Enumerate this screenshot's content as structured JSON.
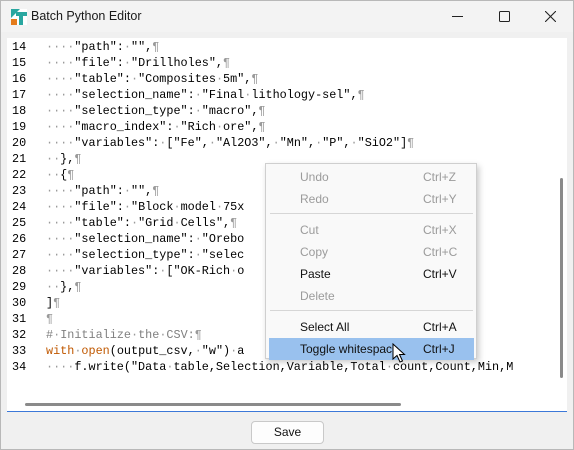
{
  "window": {
    "title": "Batch Python Editor",
    "controls": {
      "minimize": "minimize-icon",
      "maximize": "maximize-icon",
      "close": "close-icon"
    }
  },
  "editor": {
    "line_numbers": [
      "14",
      "15",
      "16",
      "17",
      "18",
      "19",
      "20",
      "21",
      "22",
      "23",
      "24",
      "25",
      "26",
      "27",
      "28",
      "29",
      "30",
      "31",
      "32",
      "33",
      "34"
    ],
    "lines": [
      [
        {
          "t": "····",
          "c": "ws"
        },
        {
          "t": "\"path\":",
          "c": ""
        },
        {
          "t": "·",
          "c": "ws"
        },
        {
          "t": "\"\",",
          "c": ""
        },
        {
          "t": "¶",
          "c": "ws"
        }
      ],
      [
        {
          "t": "····",
          "c": "ws"
        },
        {
          "t": "\"file\":",
          "c": ""
        },
        {
          "t": "·",
          "c": "ws"
        },
        {
          "t": "\"Drillholes\",",
          "c": ""
        },
        {
          "t": "¶",
          "c": "ws"
        }
      ],
      [
        {
          "t": "····",
          "c": "ws"
        },
        {
          "t": "\"table\":",
          "c": ""
        },
        {
          "t": "·",
          "c": "ws"
        },
        {
          "t": "\"Composites",
          "c": ""
        },
        {
          "t": "·",
          "c": "ws"
        },
        {
          "t": "5m\",",
          "c": ""
        },
        {
          "t": "¶",
          "c": "ws"
        }
      ],
      [
        {
          "t": "····",
          "c": "ws"
        },
        {
          "t": "\"selection_name\":",
          "c": ""
        },
        {
          "t": "·",
          "c": "ws"
        },
        {
          "t": "\"Final",
          "c": ""
        },
        {
          "t": "·",
          "c": "ws"
        },
        {
          "t": "lithology-sel\",",
          "c": ""
        },
        {
          "t": "¶",
          "c": "ws"
        }
      ],
      [
        {
          "t": "····",
          "c": "ws"
        },
        {
          "t": "\"selection_type\":",
          "c": ""
        },
        {
          "t": "·",
          "c": "ws"
        },
        {
          "t": "\"macro\",",
          "c": ""
        },
        {
          "t": "¶",
          "c": "ws"
        }
      ],
      [
        {
          "t": "····",
          "c": "ws"
        },
        {
          "t": "\"macro_index\":",
          "c": ""
        },
        {
          "t": "·",
          "c": "ws"
        },
        {
          "t": "\"Rich",
          "c": ""
        },
        {
          "t": "·",
          "c": "ws"
        },
        {
          "t": "ore\",",
          "c": ""
        },
        {
          "t": "¶",
          "c": "ws"
        }
      ],
      [
        {
          "t": "····",
          "c": "ws"
        },
        {
          "t": "\"variables\":",
          "c": ""
        },
        {
          "t": "·",
          "c": "ws"
        },
        {
          "t": "[\"Fe\",",
          "c": ""
        },
        {
          "t": "·",
          "c": "ws"
        },
        {
          "t": "\"Al2O3\",",
          "c": ""
        },
        {
          "t": "·",
          "c": "ws"
        },
        {
          "t": "\"Mn\",",
          "c": ""
        },
        {
          "t": "·",
          "c": "ws"
        },
        {
          "t": "\"P\",",
          "c": ""
        },
        {
          "t": "·",
          "c": "ws"
        },
        {
          "t": "\"SiO2\"]",
          "c": ""
        },
        {
          "t": "¶",
          "c": "ws"
        }
      ],
      [
        {
          "t": "··",
          "c": "ws"
        },
        {
          "t": "},",
          "c": ""
        },
        {
          "t": "¶",
          "c": "ws"
        }
      ],
      [
        {
          "t": "··",
          "c": "ws"
        },
        {
          "t": "{",
          "c": ""
        },
        {
          "t": "¶",
          "c": "ws"
        }
      ],
      [
        {
          "t": "····",
          "c": "ws"
        },
        {
          "t": "\"path\":",
          "c": ""
        },
        {
          "t": "·",
          "c": "ws"
        },
        {
          "t": "\"\",",
          "c": ""
        },
        {
          "t": "¶",
          "c": "ws"
        }
      ],
      [
        {
          "t": "····",
          "c": "ws"
        },
        {
          "t": "\"file\":",
          "c": ""
        },
        {
          "t": "·",
          "c": "ws"
        },
        {
          "t": "\"Block",
          "c": ""
        },
        {
          "t": "·",
          "c": "ws"
        },
        {
          "t": "model",
          "c": ""
        },
        {
          "t": "·",
          "c": "ws"
        },
        {
          "t": "75x",
          "c": ""
        }
      ],
      [
        {
          "t": "····",
          "c": "ws"
        },
        {
          "t": "\"table\":",
          "c": ""
        },
        {
          "t": "·",
          "c": "ws"
        },
        {
          "t": "\"Grid",
          "c": ""
        },
        {
          "t": "·",
          "c": "ws"
        },
        {
          "t": "Cells\",",
          "c": ""
        },
        {
          "t": "¶",
          "c": "ws"
        }
      ],
      [
        {
          "t": "····",
          "c": "ws"
        },
        {
          "t": "\"selection_name\":",
          "c": ""
        },
        {
          "t": "·",
          "c": "ws"
        },
        {
          "t": "\"Orebo",
          "c": ""
        }
      ],
      [
        {
          "t": "····",
          "c": "ws"
        },
        {
          "t": "\"selection_type\":",
          "c": ""
        },
        {
          "t": "·",
          "c": "ws"
        },
        {
          "t": "\"selec",
          "c": ""
        }
      ],
      [
        {
          "t": "····",
          "c": "ws"
        },
        {
          "t": "\"variables\":",
          "c": ""
        },
        {
          "t": "·",
          "c": "ws"
        },
        {
          "t": "[\"OK-Rich",
          "c": ""
        },
        {
          "t": "·",
          "c": "ws"
        },
        {
          "t": "o",
          "c": ""
        }
      ],
      [
        {
          "t": "··",
          "c": "ws"
        },
        {
          "t": "},",
          "c": ""
        },
        {
          "t": "¶",
          "c": "ws"
        }
      ],
      [
        {
          "t": "]",
          "c": ""
        },
        {
          "t": "¶",
          "c": "ws"
        }
      ],
      [
        {
          "t": "¶",
          "c": "ws"
        }
      ],
      [
        {
          "t": "#",
          "c": "cm"
        },
        {
          "t": "·",
          "c": "ws"
        },
        {
          "t": "Initialize",
          "c": "cm"
        },
        {
          "t": "·",
          "c": "ws"
        },
        {
          "t": "the",
          "c": "cm"
        },
        {
          "t": "·",
          "c": "ws"
        },
        {
          "t": "CSV:",
          "c": "cm"
        },
        {
          "t": "¶",
          "c": "ws"
        }
      ],
      [
        {
          "t": "with",
          "c": "kw"
        },
        {
          "t": "·",
          "c": "ws"
        },
        {
          "t": "open",
          "c": "kw"
        },
        {
          "t": "(output_csv,",
          "c": ""
        },
        {
          "t": "·",
          "c": "ws"
        },
        {
          "t": "\"w\")",
          "c": ""
        },
        {
          "t": "·",
          "c": "ws"
        },
        {
          "t": "a",
          "c": ""
        }
      ],
      [
        {
          "t": "····",
          "c": "ws"
        },
        {
          "t": "f.write(\"Data",
          "c": ""
        },
        {
          "t": "·",
          "c": "ws"
        },
        {
          "t": "table,Selection,Variable,Total",
          "c": ""
        },
        {
          "t": "·",
          "c": "ws"
        },
        {
          "t": "count,Count,Min,M",
          "c": ""
        }
      ]
    ]
  },
  "context_menu": {
    "items": [
      {
        "label": "Undo",
        "shortcut": "Ctrl+Z",
        "state": "disabled"
      },
      {
        "label": "Redo",
        "shortcut": "Ctrl+Y",
        "state": "disabled"
      },
      {
        "label": "Cut",
        "shortcut": "Ctrl+X",
        "state": "disabled"
      },
      {
        "label": "Copy",
        "shortcut": "Ctrl+C",
        "state": "disabled"
      },
      {
        "label": "Paste",
        "shortcut": "Ctrl+V",
        "state": "enabled"
      },
      {
        "label": "Delete",
        "shortcut": "",
        "state": "disabled"
      },
      {
        "label": "Select All",
        "shortcut": "Ctrl+A",
        "state": "enabled"
      },
      {
        "label": "Toggle whitespace",
        "shortcut": "Ctrl+J",
        "state": "highlighted"
      }
    ]
  },
  "footer": {
    "save_label": "Save"
  },
  "colors": {
    "comment": "#808080",
    "keyword": "#c05800",
    "whitespace_marker": "#9a9a9a",
    "menu_highlight": "#99c1ee",
    "editor_focus_border": "#3c78d8"
  }
}
